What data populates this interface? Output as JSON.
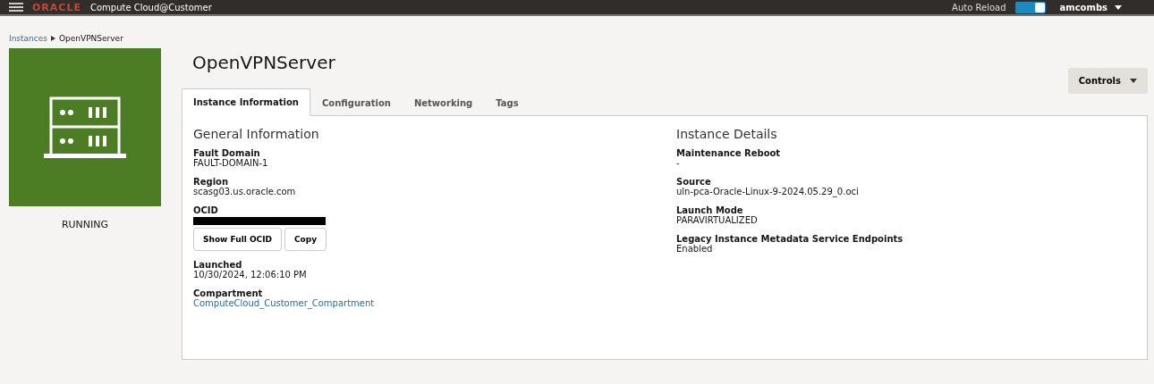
{
  "header": {
    "brand": "ORACLE",
    "product": "Compute Cloud@Customer",
    "auto_reload": {
      "label": "Auto Reload",
      "on": true
    },
    "user": "amcombs"
  },
  "breadcrumb": [
    {
      "label": "Instances",
      "link": true
    },
    {
      "label": "OpenVPNServer",
      "link": false
    }
  ],
  "instance": {
    "status": "RUNNING",
    "title": "OpenVPNServer"
  },
  "controls_button": "Controls",
  "tabs": [
    {
      "label": "Instance Information",
      "selected": true
    },
    {
      "label": "Configuration",
      "selected": false
    },
    {
      "label": "Networking",
      "selected": false
    },
    {
      "label": "Tags",
      "selected": false
    }
  ],
  "sections": [
    {
      "title": "General Information",
      "fields": [
        {
          "kind": "text",
          "label": "Fault Domain",
          "value": "FAULT-DOMAIN-1"
        },
        {
          "kind": "text",
          "label": "Region",
          "value": "scasg03.us.oracle.com"
        },
        {
          "kind": "redacted",
          "label": "OCID",
          "buttons": [
            "Show Full OCID",
            "Copy"
          ]
        },
        {
          "kind": "text",
          "label": "Launched",
          "value": "10/30/2024, 12:06:10 PM"
        },
        {
          "kind": "link",
          "label": "Compartment",
          "value": "ComputeCloud_Customer_Compartment"
        }
      ]
    },
    {
      "title": "Instance Details",
      "fields": [
        {
          "kind": "text",
          "label": "Maintenance Reboot",
          "value": "-"
        },
        {
          "kind": "text",
          "label": "Source",
          "value": "uln-pca-Oracle-Linux-9-2024.05.29_0.oci"
        },
        {
          "kind": "text",
          "label": "Launch Mode",
          "value": "PARAVIRTUALIZED"
        },
        {
          "kind": "text",
          "label": "Legacy Instance Metadata Service Endpoints",
          "value": "Enabled"
        }
      ]
    }
  ]
}
